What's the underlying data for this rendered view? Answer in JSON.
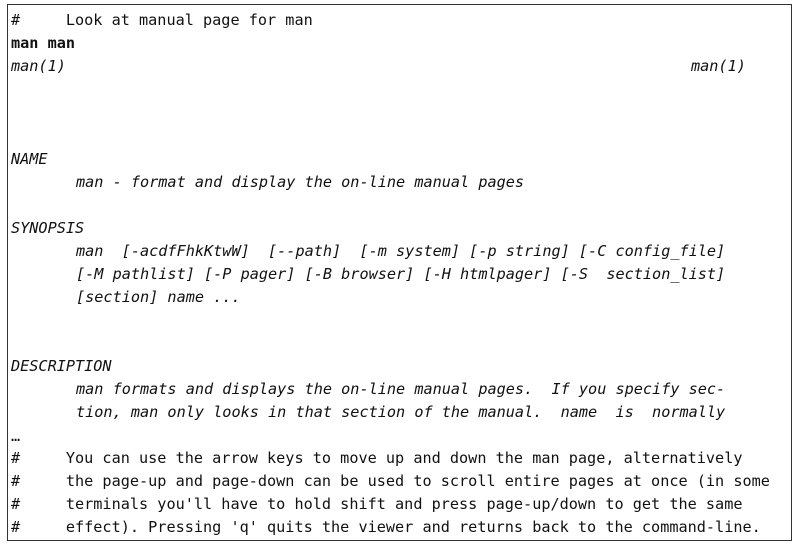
{
  "comment_top": "#     Look at manual page for man",
  "command": "man man",
  "header": {
    "left": "man(1)",
    "right": "man(1)"
  },
  "sections": {
    "name": {
      "title": "NAME",
      "lines": [
        "man - format and display the on-line manual pages"
      ]
    },
    "synopsis": {
      "title": "SYNOPSIS",
      "lines": [
        "man  [-acdfFhkKtwW]  [--path]  [-m system] [-p string] [-C config_file]",
        "[-M pathlist] [-P pager] [-B browser] [-H htmlpager] [-S  section_list]",
        "[section] name ..."
      ]
    },
    "description": {
      "title": "DESCRIPTION",
      "lines": [
        "man formats and displays the on-line manual pages.  If you specify sec-",
        "tion, man only looks in that section of the manual.  name  is  normally"
      ]
    }
  },
  "ellipsis": "…",
  "comment_bottom": [
    "#     You can use the arrow keys to move up and down the man page, alternatively",
    "#     the page-up and page-down can be used to scroll entire pages at once (in some",
    "#     terminals you'll have to hold shift and press page-up/down to get the same",
    "#     effect). Pressing 'q' quits the viewer and returns back to the command-line."
  ]
}
